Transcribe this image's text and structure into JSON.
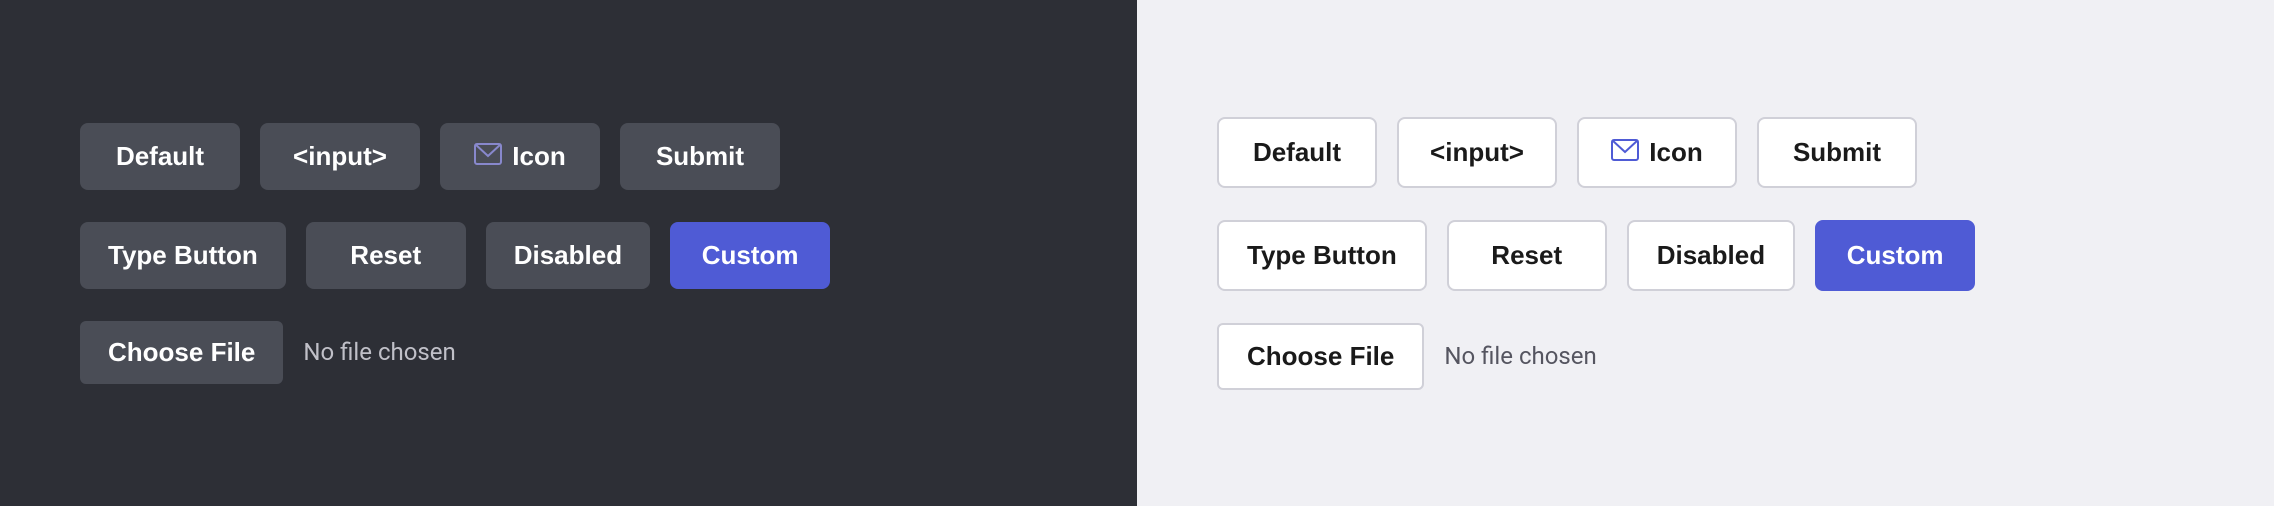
{
  "dark_panel": {
    "row1": {
      "btn1": "Default",
      "btn2": "<input>",
      "btn3_icon": "mail-icon",
      "btn3_label": "Icon",
      "btn4": "Submit"
    },
    "row2": {
      "btn1": "Type Button",
      "btn2": "Reset",
      "btn3": "Disabled",
      "btn4": "Custom"
    },
    "file_row": {
      "btn": "Choose File",
      "label": "No file chosen"
    }
  },
  "light_panel": {
    "row1": {
      "btn1": "Default",
      "btn2": "<input>",
      "btn3_icon": "mail-icon",
      "btn3_label": "Icon",
      "btn4": "Submit"
    },
    "row2": {
      "btn1": "Type Button",
      "btn2": "Reset",
      "btn3": "Disabled",
      "btn4": "Custom"
    },
    "file_row": {
      "btn": "Choose File",
      "label": "No file chosen"
    }
  }
}
